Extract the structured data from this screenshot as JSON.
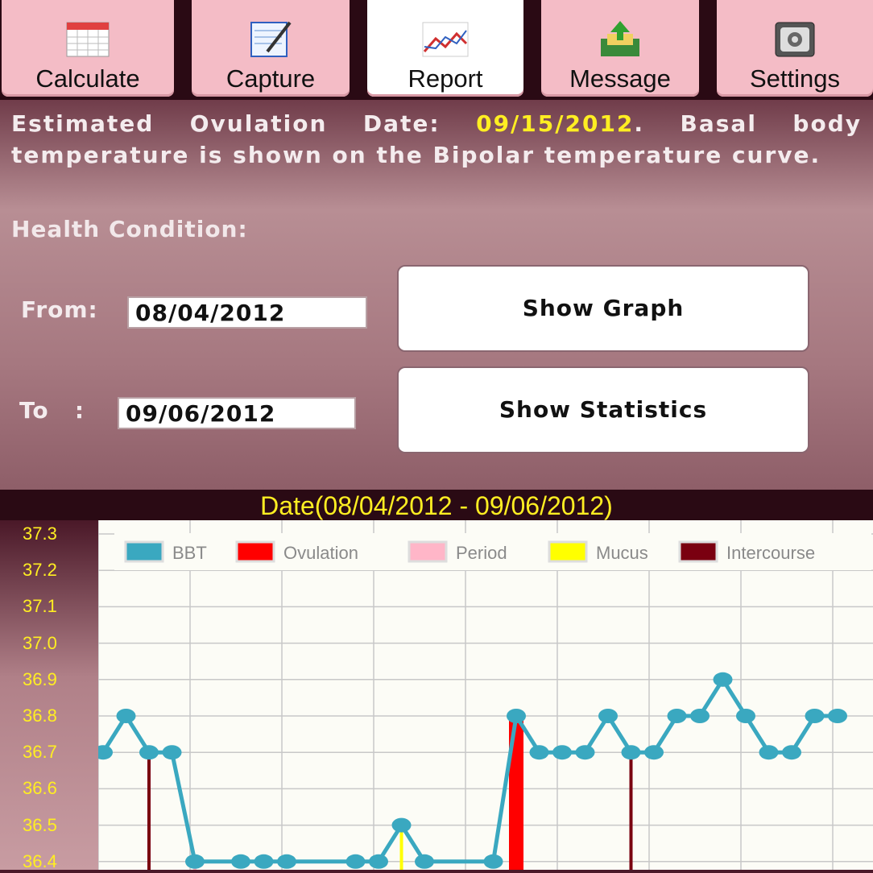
{
  "tabs": [
    {
      "label": "Calculate",
      "icon": "calendar-icon",
      "active": false
    },
    {
      "label": "Capture",
      "icon": "notepad-pencil-icon",
      "active": false
    },
    {
      "label": "Report",
      "icon": "line-chart-icon",
      "active": true
    },
    {
      "label": "Message",
      "icon": "inbox-upload-icon",
      "active": false
    },
    {
      "label": "Settings",
      "icon": "gear-settings-icon",
      "active": false
    }
  ],
  "info": {
    "prefix": "Estimated Ovulation Date: ",
    "ovulation_date": "09/15/2012",
    "suffix": ". Basal body temperature is shown on the Bipolar temperature curve."
  },
  "health_label": "Health Condition:",
  "from": {
    "label": "From:",
    "value": "08/04/2012"
  },
  "to": {
    "label": "To   :",
    "value": "09/06/2012"
  },
  "buttons": {
    "show_graph": "Show Graph",
    "show_statistics": "Show Statistics"
  },
  "colors": {
    "bbt": "#3aa8c0",
    "ovulation": "#ff0000",
    "period": "#ffb6c8",
    "mucus": "#ffff00",
    "intercourse": "#7a0010",
    "axis_text": "#ffee22"
  },
  "chart_data": {
    "type": "line",
    "title": "Date(08/04/2012 - 09/06/2012)",
    "xlabel": "",
    "ylabel": "",
    "ylim": [
      36.4,
      37.3
    ],
    "yticks": [
      "37.3",
      "37.2",
      "37.1",
      "37.0",
      "36.9",
      "36.8",
      "36.7",
      "36.6",
      "36.5",
      "36.4"
    ],
    "grid": true,
    "legend_position": "top",
    "legend": [
      "BBT",
      "Ovulation",
      "Period",
      "Mucus",
      "Intercourse"
    ],
    "bbt": [
      {
        "day": 0,
        "value": 36.7
      },
      {
        "day": 1,
        "value": 36.8
      },
      {
        "day": 2,
        "value": 36.7
      },
      {
        "day": 3,
        "value": 36.7
      },
      {
        "day": 4,
        "value": 36.4
      },
      {
        "day": 6,
        "value": 36.4
      },
      {
        "day": 7,
        "value": 36.4
      },
      {
        "day": 8,
        "value": 36.4
      },
      {
        "day": 11,
        "value": 36.4
      },
      {
        "day": 12,
        "value": 36.4
      },
      {
        "day": 13,
        "value": 36.5
      },
      {
        "day": 14,
        "value": 36.4
      },
      {
        "day": 17,
        "value": 36.4
      },
      {
        "day": 18,
        "value": 36.8
      },
      {
        "day": 19,
        "value": 36.7
      },
      {
        "day": 20,
        "value": 36.7
      },
      {
        "day": 21,
        "value": 36.7
      },
      {
        "day": 22,
        "value": 36.8
      },
      {
        "day": 23,
        "value": 36.7
      },
      {
        "day": 24,
        "value": 36.7
      },
      {
        "day": 25,
        "value": 36.8
      },
      {
        "day": 26,
        "value": 36.8
      },
      {
        "day": 27,
        "value": 36.9
      },
      {
        "day": 28,
        "value": 36.8
      },
      {
        "day": 29,
        "value": 36.7
      },
      {
        "day": 30,
        "value": 36.7
      },
      {
        "day": 31,
        "value": 36.8
      },
      {
        "day": 32,
        "value": 36.8
      }
    ],
    "markers": [
      {
        "type": "intercourse",
        "day": 2,
        "value": 36.7
      },
      {
        "type": "period",
        "day": 4,
        "value": 36.4
      },
      {
        "type": "mucus",
        "day": 13,
        "value": 36.5
      },
      {
        "type": "ovulation",
        "day": 18,
        "value": 36.8
      },
      {
        "type": "intercourse",
        "day": 23,
        "value": 36.7
      }
    ]
  }
}
